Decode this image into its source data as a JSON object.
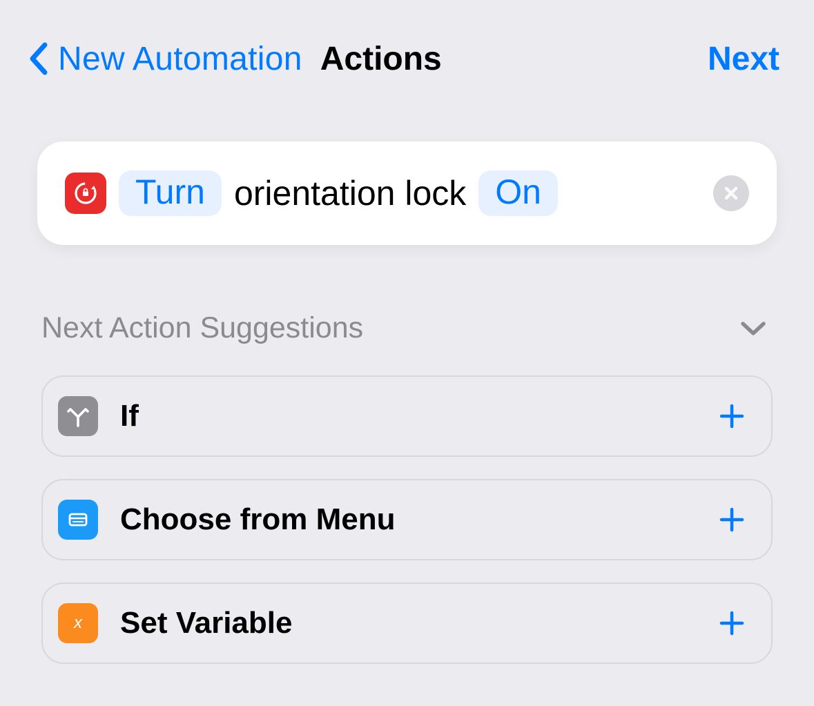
{
  "header": {
    "back_label": "New Automation",
    "title": "Actions",
    "next_label": "Next"
  },
  "action": {
    "operation": "Turn",
    "target": "orientation lock",
    "state": "On"
  },
  "suggestions": {
    "title": "Next Action Suggestions",
    "items": [
      {
        "label": "If"
      },
      {
        "label": "Choose from Menu"
      },
      {
        "label": "Set Variable"
      }
    ]
  },
  "colors": {
    "accent": "#007aff",
    "background": "#ecebf0",
    "card": "#ffffff",
    "close_btn": "#d8d8dc",
    "red_icon": "#e92c2c",
    "gray_icon": "#8e8e93",
    "blue_icon": "#1b9af7",
    "orange_icon": "#fb8b1e"
  }
}
